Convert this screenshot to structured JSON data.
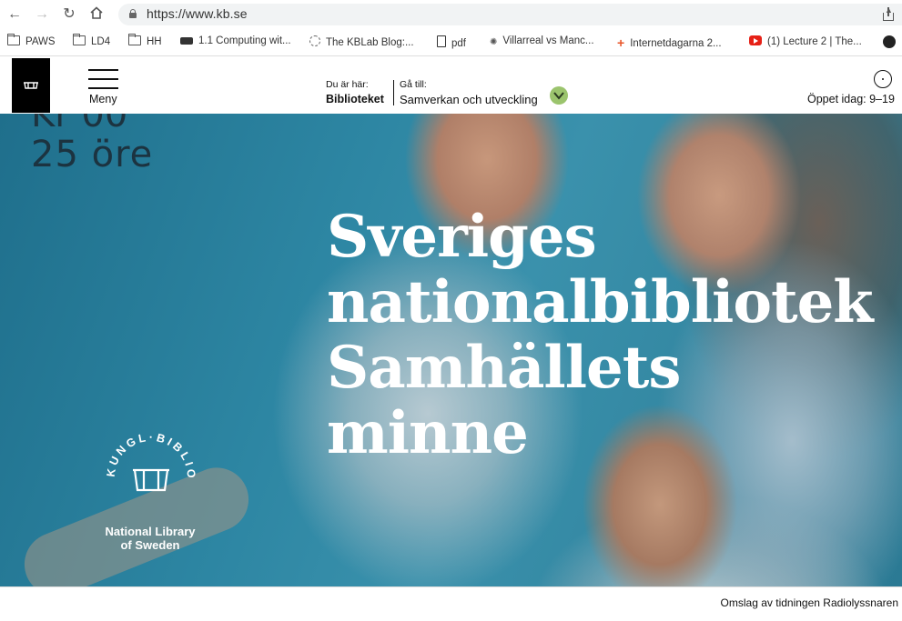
{
  "browser": {
    "url": "https://www.kb.se",
    "bookmarks": [
      {
        "label": "PAWS",
        "icon": "folder-icon"
      },
      {
        "label": "LD4",
        "icon": "folder-icon"
      },
      {
        "label": "HH",
        "icon": "folder-icon"
      },
      {
        "label": "1.1 Computing wit...",
        "icon": "site-icon"
      },
      {
        "label": "The KBLab Blog:...",
        "icon": "site-icon"
      },
      {
        "label": "pdf",
        "icon": "document-icon"
      },
      {
        "label": "Villarreal vs Manc...",
        "icon": "site-icon"
      },
      {
        "label": "Internetdagarna 2...",
        "icon": "plus-icon"
      },
      {
        "label": "(1) Lecture 2 | The...",
        "icon": "youtube-icon"
      }
    ]
  },
  "header": {
    "menu_label": "Meny",
    "here_label": "Du är här:",
    "here_value": "Biblioteket",
    "goto_label": "Gå till:",
    "goto_value": "Samverkan och utveckling",
    "hours": "Öppet idag: 9–19",
    "accent_color": "#9bc46d"
  },
  "hero": {
    "headline": [
      "Sveriges",
      "nationalbibliotek",
      "Samhällets",
      "minne"
    ],
    "poster_price": "25 öre",
    "seal_arc_text": "KUNGL·BIBLIOTEKET",
    "seal_caption_1": "National Library",
    "seal_caption_2": "of Sweden"
  },
  "caption": "Omslag av tidningen Radiolyssnaren"
}
